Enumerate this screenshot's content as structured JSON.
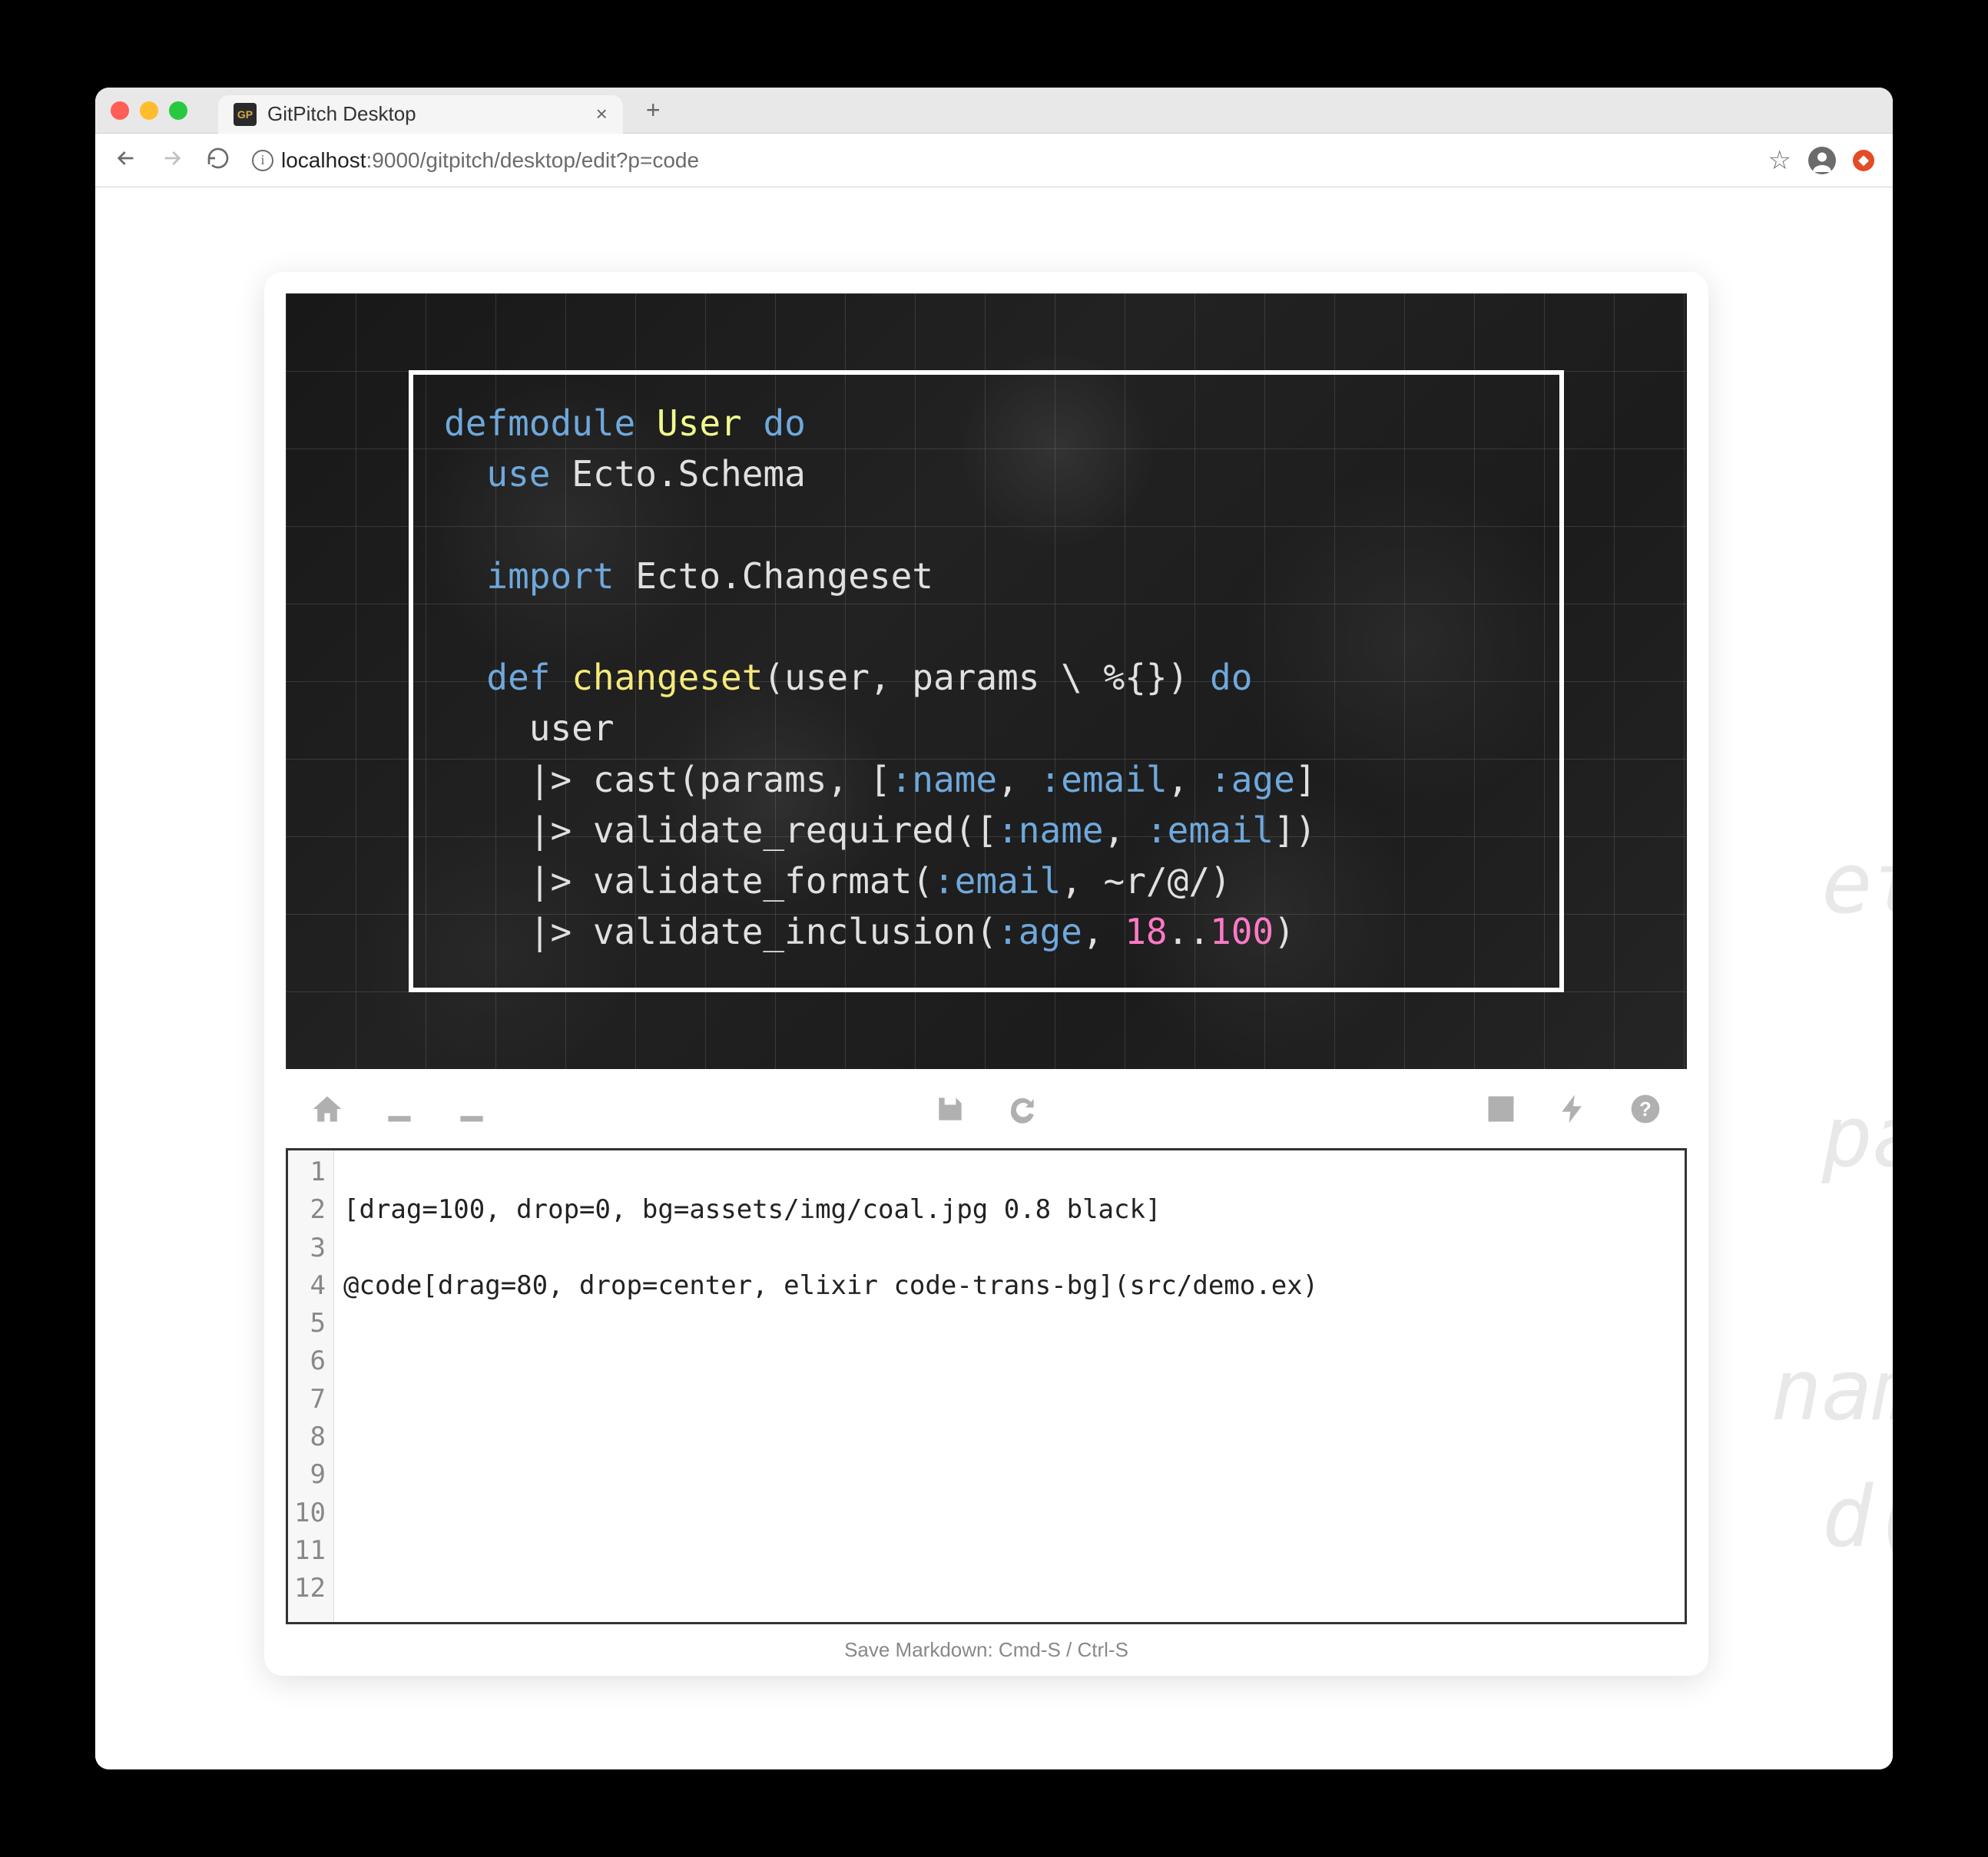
{
  "browser": {
    "tab_title": "GitPitch Desktop",
    "favicon_text": "GP",
    "url_host": "localhost",
    "url_port": ":9000",
    "url_path": "/gitpitch/desktop/edit?p=code"
  },
  "slide": {
    "code_lines": [
      {
        "tokens": [
          [
            "kw",
            "defmodule"
          ],
          [
            "sp",
            " "
          ],
          [
            "type",
            "User"
          ],
          [
            "sp",
            " "
          ],
          [
            "kw",
            "do"
          ]
        ]
      },
      {
        "tokens": [
          [
            "sp",
            "  "
          ],
          [
            "kw",
            "use"
          ],
          [
            "sp",
            " "
          ],
          [
            "op",
            "Ecto.Schema"
          ]
        ]
      },
      {
        "tokens": []
      },
      {
        "tokens": [
          [
            "sp",
            "  "
          ],
          [
            "kw",
            "import"
          ],
          [
            "sp",
            " "
          ],
          [
            "op",
            "Ecto.Changeset"
          ]
        ]
      },
      {
        "tokens": []
      },
      {
        "tokens": [
          [
            "sp",
            "  "
          ],
          [
            "kw",
            "def"
          ],
          [
            "sp",
            " "
          ],
          [
            "fn",
            "changeset"
          ],
          [
            "op",
            "(user, params \\\\ %{}) "
          ],
          [
            "kw",
            "do"
          ]
        ]
      },
      {
        "tokens": [
          [
            "sp",
            "    "
          ],
          [
            "op",
            "user"
          ]
        ]
      },
      {
        "tokens": [
          [
            "sp",
            "    "
          ],
          [
            "op",
            "|> cast(params, ["
          ],
          [
            "atom",
            ":name"
          ],
          [
            "op",
            ", "
          ],
          [
            "atom",
            ":email"
          ],
          [
            "op",
            ", "
          ],
          [
            "atom",
            ":age"
          ],
          [
            "op",
            "]"
          ]
        ]
      },
      {
        "tokens": [
          [
            "sp",
            "    "
          ],
          [
            "op",
            "|> validate_required(["
          ],
          [
            "atom",
            ":name"
          ],
          [
            "op",
            ", "
          ],
          [
            "atom",
            ":email"
          ],
          [
            "op",
            "])"
          ]
        ]
      },
      {
        "tokens": [
          [
            "sp",
            "    "
          ],
          [
            "op",
            "|> validate_format("
          ],
          [
            "atom",
            ":email"
          ],
          [
            "op",
            ", ~r/@/)"
          ]
        ]
      },
      {
        "tokens": [
          [
            "sp",
            "    "
          ],
          [
            "op",
            "|> validate_inclusion("
          ],
          [
            "atom",
            ":age"
          ],
          [
            "op",
            ", "
          ],
          [
            "num",
            "18"
          ],
          [
            "op",
            ".."
          ],
          [
            "num",
            "100"
          ],
          [
            "op",
            ")"
          ]
        ]
      }
    ]
  },
  "toolbar": {
    "home": "home-icon",
    "download": "download-icon",
    "upload": "upload-icon",
    "save": "save-icon",
    "refresh": "refresh-icon",
    "image": "image-icon",
    "flash": "flash-icon",
    "help": "help-icon"
  },
  "editor": {
    "line_count": 12,
    "lines": [
      "",
      "[drag=100, drop=0, bg=assets/img/coal.jpg 0.8 black]",
      "",
      "@code[drag=80, drop=center, elixir code-trans-bg](src/demo.ex)",
      "",
      "",
      "",
      "",
      "",
      "",
      "",
      ""
    ]
  },
  "status_hint": "Save Markdown: Cmd-S / Ctrl-S",
  "bg_snippets": [
    "et",
    "pa",
    "nam",
    "d("
  ]
}
